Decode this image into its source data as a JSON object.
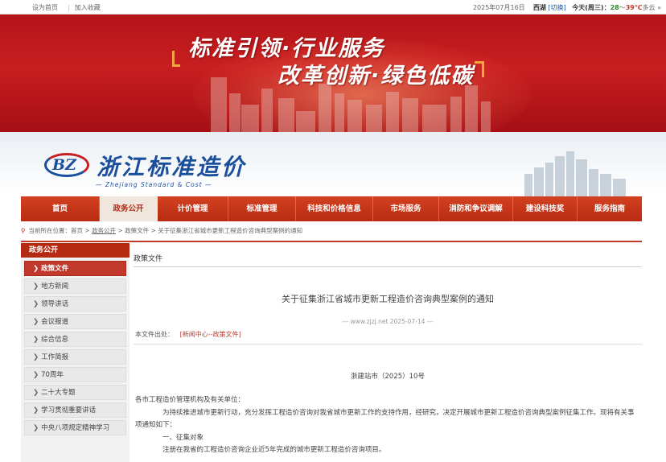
{
  "topbar": {
    "set_home": "设为首页",
    "separator": "|",
    "favorite": "加入收藏",
    "date": "2025年07月16日",
    "city": "西湖",
    "switch": "[切换]",
    "weather_prefix": "今天(周三)：",
    "temp_low": "28",
    "temp_sep": "～",
    "temp_high": "39℃",
    "weather_desc": "多云",
    "more": "»"
  },
  "banner": {
    "slogan_line1": "标准引领·行业服务",
    "slogan_line2": "改革创新·绿色低碳"
  },
  "logo": {
    "mark": "BZ",
    "name_cn": "浙江标准造价",
    "name_en": "— Zhejiang Standard & Cost —"
  },
  "nav": {
    "items": [
      {
        "label": "首页"
      },
      {
        "label": "政务公开"
      },
      {
        "label": "计价管理"
      },
      {
        "label": "标准管理"
      },
      {
        "label": "科技和价格信息"
      },
      {
        "label": "市场服务"
      },
      {
        "label": "消防和争议调解"
      },
      {
        "label": "建设科技奖"
      },
      {
        "label": "服务指南"
      }
    ],
    "active_index": 1
  },
  "breadcrumb": {
    "prefix": "当前所在位置：",
    "home": "首页",
    "sep": " > ",
    "level1": "政务公开",
    "level2": "政策文件",
    "current": "关于征集浙江省城市更新工程造价咨询典型案例的通知"
  },
  "sidebar": {
    "heading": "政务公开",
    "items": [
      {
        "label": "政策文件"
      },
      {
        "label": "地方新闻"
      },
      {
        "label": "领导讲话"
      },
      {
        "label": "会议报道"
      },
      {
        "label": "综合信息"
      },
      {
        "label": "工作简报"
      },
      {
        "label": "70周年"
      },
      {
        "label": "二十大专题"
      },
      {
        "label": "学习贯彻重要讲话"
      },
      {
        "label": "中央八项规定精神学习"
      }
    ],
    "active_index": 0
  },
  "article": {
    "section": "政策文件",
    "title": "关于征集浙江省城市更新工程造价咨询典型案例的通知",
    "meta": "--- www.zjzj.net 2025-07-14 ---",
    "source_label": "本文件出处：",
    "source_link": "[新闻中心--政策文件]",
    "doc_no": "浙建站市（2025）10号",
    "salutation": "各市工程造价管理机构及有关单位：",
    "para1": "为持续推进城市更新行动，充分发挥工程造价咨询对我省城市更新工作的支持作用，经研究，决定开展城市更新工程造价咨询典型案例征集工作。现将有关事项通知如下：",
    "heading1": "一、征集对象",
    "para2": "注册在我省的工程造价咨询企业近5年完成的城市更新工程造价咨询项目。"
  }
}
